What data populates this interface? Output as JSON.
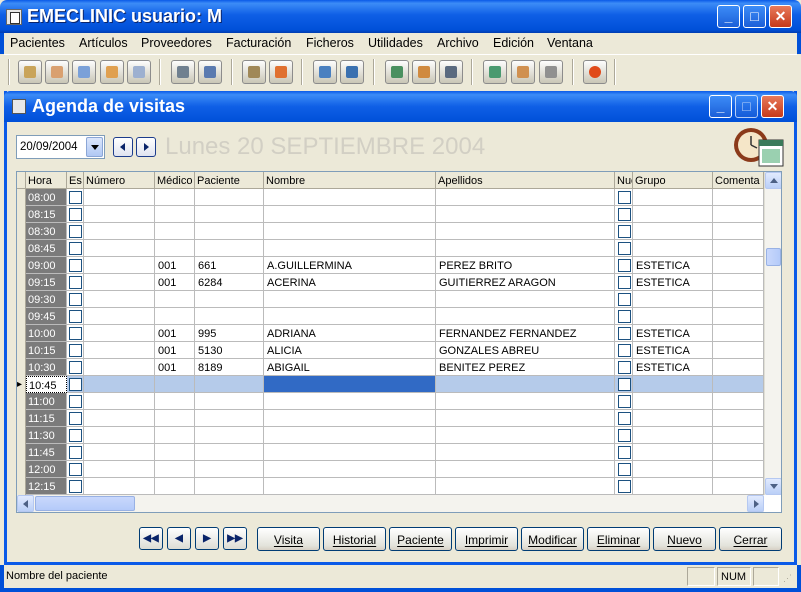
{
  "window": {
    "title": "EMECLINIC usuario: M"
  },
  "menu": [
    "Pacientes",
    "Artículos",
    "Proveedores",
    "Facturación",
    "Ficheros",
    "Utilidades",
    "Archivo",
    "Edición",
    "Ventana"
  ],
  "toolbar_icons": [
    "calendar-icon",
    "patient-icon",
    "patient-card-icon",
    "patients-group-icon",
    "patient-search-icon",
    "calculator-icon",
    "doctor-icon",
    "box-icon",
    "house-icon",
    "globe-icon",
    "globe-edit-icon",
    "invoice-icon",
    "people-icon",
    "database-icon",
    "notebook-icon",
    "contacts-icon",
    "printer-icon",
    "power-exit-icon"
  ],
  "agenda": {
    "title": "Agenda de visitas",
    "date_value": "20/09/2004",
    "big_date": "Lunes 20 SEPTIEMBRE 2004"
  },
  "grid": {
    "columns": [
      "Hora",
      "Estado",
      "Número",
      "Médico",
      "Paciente",
      "Nombre",
      "Apellidos",
      "Nuevo",
      "Grupo",
      "Comentario"
    ],
    "columns_shown": [
      "Hora",
      "Es",
      "Número",
      "Médico",
      "Paciente",
      "Nombre",
      "Apellidos",
      "Nue",
      "Grupo",
      "Comenta"
    ],
    "rows": [
      {
        "hora": "08:00",
        "medico": "",
        "paciente": "",
        "nombre": "",
        "apellidos": "",
        "grupo": ""
      },
      {
        "hora": "08:15",
        "medico": "",
        "paciente": "",
        "nombre": "",
        "apellidos": "",
        "grupo": ""
      },
      {
        "hora": "08:30",
        "medico": "",
        "paciente": "",
        "nombre": "",
        "apellidos": "",
        "grupo": ""
      },
      {
        "hora": "08:45",
        "medico": "",
        "paciente": "",
        "nombre": "",
        "apellidos": "",
        "grupo": ""
      },
      {
        "hora": "09:00",
        "medico": "001",
        "paciente": "661",
        "nombre": "A.GUILLERMINA",
        "apellidos": "PEREZ BRITO",
        "grupo": "ESTETICA"
      },
      {
        "hora": "09:15",
        "medico": "001",
        "paciente": "6284",
        "nombre": "ACERINA",
        "apellidos": "GUITIERREZ ARAGON",
        "grupo": "ESTETICA"
      },
      {
        "hora": "09:30",
        "medico": "",
        "paciente": "",
        "nombre": "",
        "apellidos": "",
        "grupo": ""
      },
      {
        "hora": "09:45",
        "medico": "",
        "paciente": "",
        "nombre": "",
        "apellidos": "",
        "grupo": ""
      },
      {
        "hora": "10:00",
        "medico": "001",
        "paciente": "995",
        "nombre": "ADRIANA",
        "apellidos": "FERNANDEZ FERNANDEZ",
        "grupo": "ESTETICA"
      },
      {
        "hora": "10:15",
        "medico": "001",
        "paciente": "5130",
        "nombre": "ALICIA",
        "apellidos": "GONZALES ABREU",
        "grupo": "ESTETICA"
      },
      {
        "hora": "10:30",
        "medico": "001",
        "paciente": "8189",
        "nombre": "ABIGAIL",
        "apellidos": "BENITEZ PEREZ",
        "grupo": "ESTETICA"
      },
      {
        "hora": "10:45",
        "medico": "",
        "paciente": "",
        "nombre": "",
        "apellidos": "",
        "grupo": "",
        "selected": true
      },
      {
        "hora": "11:00",
        "medico": "",
        "paciente": "",
        "nombre": "",
        "apellidos": "",
        "grupo": ""
      },
      {
        "hora": "11:15",
        "medico": "",
        "paciente": "",
        "nombre": "",
        "apellidos": "",
        "grupo": ""
      },
      {
        "hora": "11:30",
        "medico": "",
        "paciente": "",
        "nombre": "",
        "apellidos": "",
        "grupo": ""
      },
      {
        "hora": "11:45",
        "medico": "",
        "paciente": "",
        "nombre": "",
        "apellidos": "",
        "grupo": ""
      },
      {
        "hora": "12:00",
        "medico": "",
        "paciente": "",
        "nombre": "",
        "apellidos": "",
        "grupo": ""
      },
      {
        "hora": "12:15",
        "medico": "",
        "paciente": "",
        "nombre": "",
        "apellidos": "",
        "grupo": ""
      }
    ]
  },
  "buttons": {
    "visita": "Visita",
    "historial": "Historial",
    "paciente": "Paciente",
    "imprimir": "Imprimir",
    "modificar": "Modificar",
    "eliminar": "Eliminar",
    "nuevo": "Nuevo",
    "cerrar": "Cerrar"
  },
  "status": {
    "text": "Nombre del paciente",
    "num": "NUM"
  },
  "colors": {
    "xp_blue": "#0050D8",
    "selected_row": "#B5CBEA",
    "hour_cell": "#7B7B7B",
    "focus_cell": "#316AC5"
  }
}
